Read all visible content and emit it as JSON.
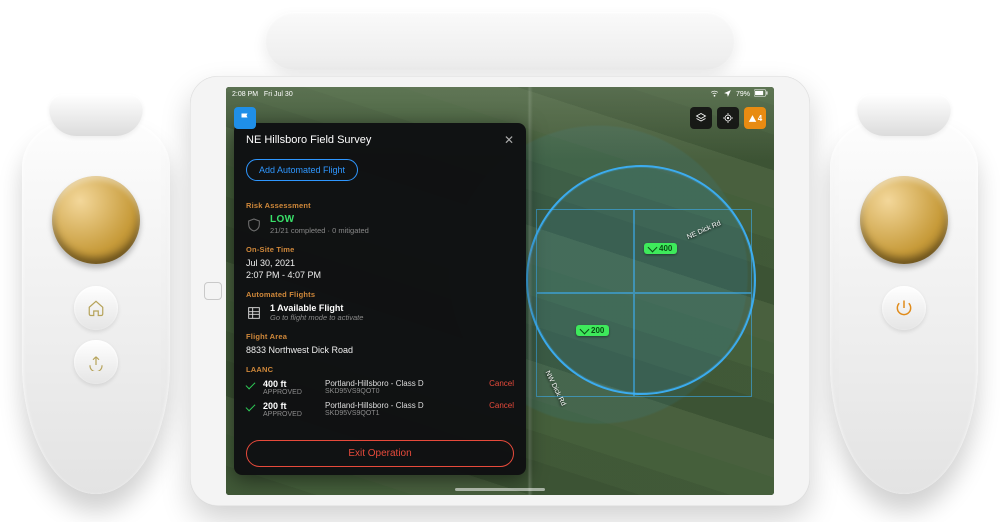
{
  "statusbar": {
    "time": "2:08 PM",
    "date": "Fri Jul 30",
    "battery": "79%"
  },
  "map": {
    "marker_400": "400",
    "marker_200": "200",
    "road_ne": "NE Dick Rd",
    "road_nw": "NW Dick Rd",
    "alerts_count": "4"
  },
  "panel": {
    "title": "NE Hillsboro Field Survey",
    "add_flight_label": "Add Automated Flight",
    "sections": {
      "risk": {
        "label": "Risk Assessment",
        "level": "LOW",
        "detail": "21/21 completed · 0 mitigated"
      },
      "onsite": {
        "label": "On-Site Time",
        "date": "Jul 30, 2021",
        "range": "2:07 PM - 4:07 PM"
      },
      "automated": {
        "label": "Automated Flights",
        "title": "1 Available Flight",
        "sub": "Go to flight mode to activate"
      },
      "area": {
        "label": "Flight Area",
        "address": "8833 Northwest Dick Road"
      },
      "laanc": {
        "label": "LAANC",
        "items": [
          {
            "alt": "400 ft",
            "status": "APPROVED",
            "airspace": "Portland-Hillsboro - Class D",
            "id": "SKD95VS9QOT0",
            "cancel": "Cancel"
          },
          {
            "alt": "200 ft",
            "status": "APPROVED",
            "airspace": "Portland-Hillsboro - Class D",
            "id": "SKD95VS9QOT1",
            "cancel": "Cancel"
          }
        ]
      }
    },
    "exit_label": "Exit Operation"
  }
}
